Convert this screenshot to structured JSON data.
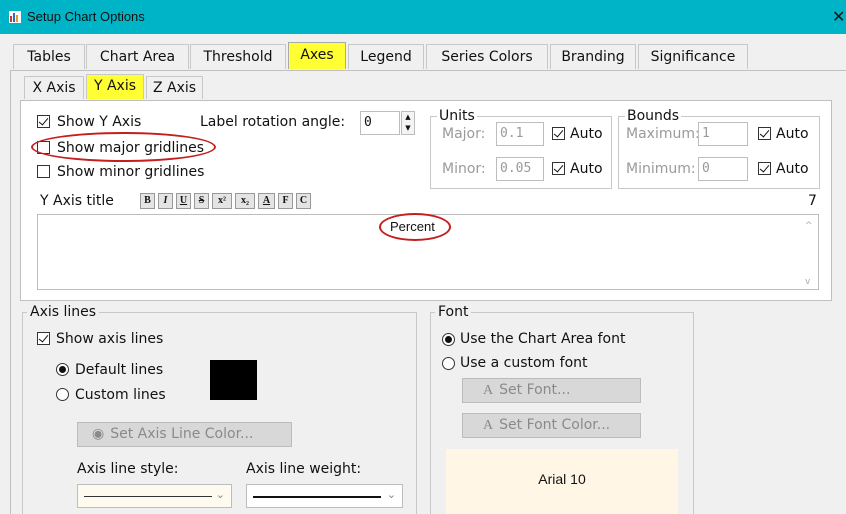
{
  "window": {
    "title": "Setup Chart Options",
    "close_glyph": "✕"
  },
  "tabs": [
    {
      "label": "Tables",
      "selected": false
    },
    {
      "label": "Chart Area",
      "selected": false
    },
    {
      "label": "Threshold",
      "selected": false
    },
    {
      "label": "Axes",
      "selected": true
    },
    {
      "label": "Legend",
      "selected": false
    },
    {
      "label": "Series Colors",
      "selected": false
    },
    {
      "label": "Branding",
      "selected": false
    },
    {
      "label": "Significance",
      "selected": false
    }
  ],
  "axis_tabs": [
    {
      "label": "X Axis",
      "selected": false
    },
    {
      "label": "Y Axis",
      "selected": true
    },
    {
      "label": "Z Axis",
      "selected": false
    }
  ],
  "y_axis": {
    "show_y_axis": {
      "label": "Show Y Axis",
      "checked": true
    },
    "show_major_gridlines": {
      "label": "Show major gridlines",
      "checked": false
    },
    "show_minor_gridlines": {
      "label": "Show minor gridlines",
      "checked": false
    },
    "label_rotation": {
      "label": "Label rotation angle:",
      "value": "0"
    },
    "units": {
      "legend": "Units",
      "major_label": "Major:",
      "major_value": "0.1",
      "minor_label": "Minor:",
      "minor_value": "0.05",
      "auto_label": "Auto",
      "major_auto": true,
      "minor_auto": true
    },
    "bounds": {
      "legend": "Bounds",
      "maximum_label": "Maximum:",
      "maximum_value": "1",
      "minimum_label": "Minimum:",
      "minimum_value": "0",
      "auto_label": "Auto",
      "maximum_auto": true,
      "minimum_auto": true
    },
    "title_label": "Y Axis title",
    "format_buttons": [
      "B",
      "I",
      "U",
      "S",
      "x²",
      "x₂",
      "A",
      "F",
      "C"
    ],
    "char_count": "7",
    "title_value": "Percent"
  },
  "axis_lines": {
    "legend": "Axis lines",
    "show_axis_lines": {
      "label": "Show axis lines",
      "checked": true
    },
    "default_lines": {
      "label": "Default lines",
      "selected": true
    },
    "custom_lines": {
      "label": "Custom lines",
      "selected": false
    },
    "line_color": "#000000",
    "set_color_button": "Set Axis Line Color...",
    "style_label": "Axis line style:",
    "weight_label": "Axis line weight:"
  },
  "font": {
    "legend": "Font",
    "use_chart_font": {
      "label": "Use the Chart Area font",
      "selected": true
    },
    "use_custom_font": {
      "label": "Use a custom font",
      "selected": false
    },
    "set_font_button": "Set Font...",
    "set_font_color_button": "Set Font Color...",
    "preview_text": "Arial 10",
    "preview_bg": "#fff6e6"
  },
  "colors": {
    "titlebar": "#00b4c8",
    "selected_tab": "#ffff33",
    "annotation_ring": "#c41e1e"
  }
}
